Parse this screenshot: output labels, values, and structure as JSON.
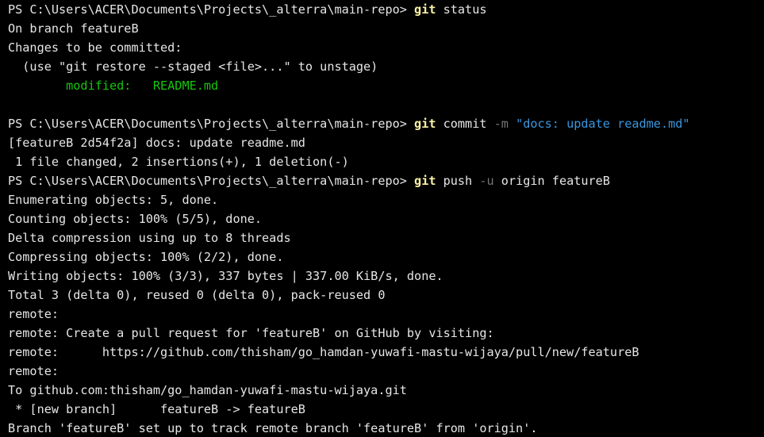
{
  "colors": {
    "background": "#000000",
    "foreground": "#e6e6e6",
    "command": "#f9f1a5",
    "flag": "#767676",
    "string": "#3a96dd",
    "staged": "#16c60c"
  },
  "prompt": "PS C:\\Users\\ACER\\Documents\\Projects\\_alterra\\main-repo> ",
  "commands": {
    "status": {
      "cmd": "git",
      "args": " status"
    },
    "commit": {
      "cmd": "git",
      "args": " commit ",
      "flag": "-m",
      "message": " \"docs: update readme.md\""
    },
    "push": {
      "cmd": "git",
      "args": " push ",
      "flag": "-u",
      "rest": " origin featureB"
    }
  },
  "status_output": {
    "branch": "On branch featureB",
    "changes": "Changes to be committed:",
    "hint": "  (use \"git restore --staged <file>...\" to unstage)",
    "modified_label": "        modified:   ",
    "modified_file": "README.md"
  },
  "commit_output": {
    "line1": "[featureB 2d54f2a] docs: update readme.md",
    "line2": " 1 file changed, 2 insertions(+), 1 deletion(-)"
  },
  "push_output": [
    "Enumerating objects: 5, done.",
    "Counting objects: 100% (5/5), done.",
    "Delta compression using up to 8 threads",
    "Compressing objects: 100% (2/2), done.",
    "Writing objects: 100% (3/3), 337 bytes | 337.00 KiB/s, done.",
    "Total 3 (delta 0), reused 0 (delta 0), pack-reused 0",
    "remote:",
    "remote: Create a pull request for 'featureB' on GitHub by visiting:",
    "remote:      https://github.com/thisham/go_hamdan-yuwafi-mastu-wijaya/pull/new/featureB",
    "remote:",
    "To github.com:thisham/go_hamdan-yuwafi-mastu-wijaya.git",
    " * [new branch]      featureB -> featureB",
    "Branch 'featureB' set up to track remote branch 'featureB' from 'origin'."
  ]
}
